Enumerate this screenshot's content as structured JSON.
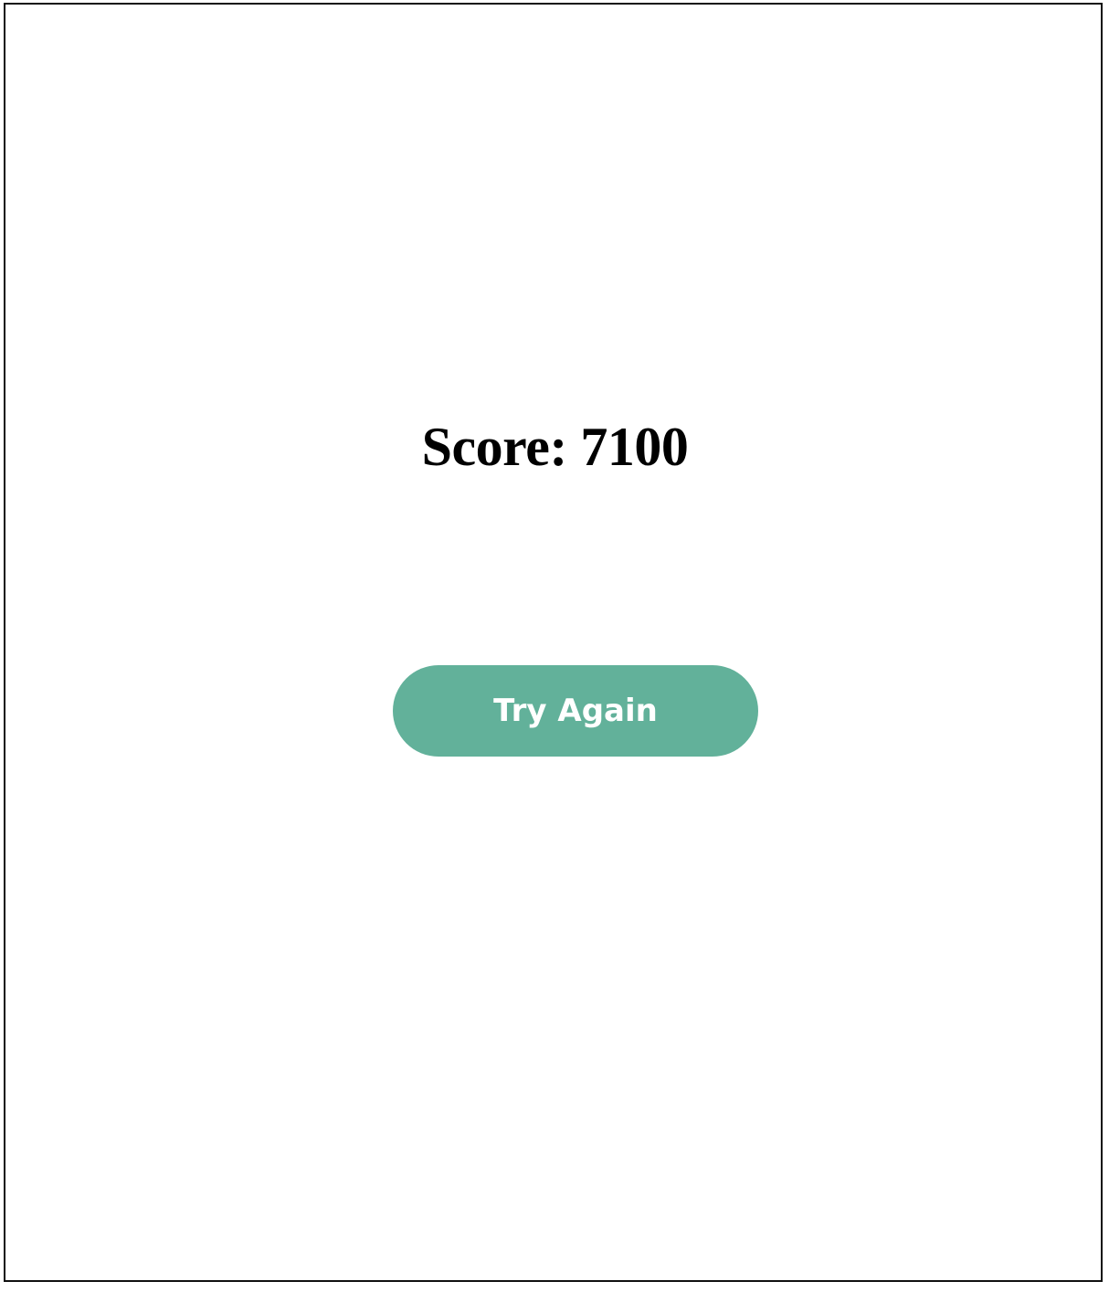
{
  "game_over": {
    "score_label": "Score: 7100",
    "try_again_label": "Try Again"
  },
  "colors": {
    "button_background": "#62b19a",
    "button_text": "#ffffff",
    "score_text": "#000000",
    "frame_border": "#111111",
    "background": "#ffffff"
  }
}
